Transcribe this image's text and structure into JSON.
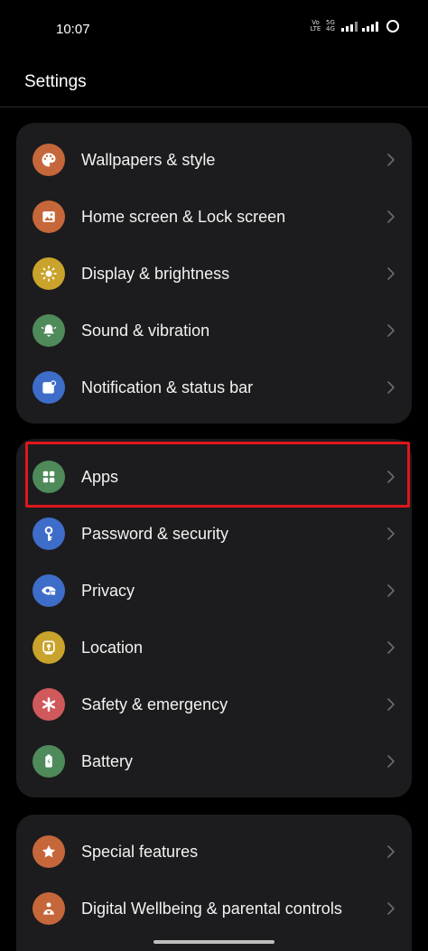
{
  "status_bar": {
    "time": "10:07",
    "volte_label": "Vo\nLTE",
    "network_label": "5G\n4G"
  },
  "header": {
    "title": "Settings"
  },
  "groups": [
    {
      "items": [
        {
          "label": "Wallpapers & style",
          "icon": "palette-icon",
          "color": "#c5673a"
        },
        {
          "label": "Home screen & Lock screen",
          "icon": "image-icon",
          "color": "#c5673a"
        },
        {
          "label": "Display & brightness",
          "icon": "sun-icon",
          "color": "#c9a32b"
        },
        {
          "label": "Sound & vibration",
          "icon": "bell-icon",
          "color": "#4f8a5a"
        },
        {
          "label": "Notification & status bar",
          "icon": "notification-icon",
          "color": "#3d6dc8"
        }
      ]
    },
    {
      "items": [
        {
          "label": "Apps",
          "icon": "apps-grid-icon",
          "color": "#4f8a5a"
        },
        {
          "label": "Password & security",
          "icon": "key-icon",
          "color": "#3d6dc8"
        },
        {
          "label": "Privacy",
          "icon": "eye-lock-icon",
          "color": "#3d6dc8"
        },
        {
          "label": "Location",
          "icon": "location-pin-icon",
          "color": "#c9a32b"
        },
        {
          "label": "Safety & emergency",
          "icon": "asterisk-icon",
          "color": "#d0595b"
        },
        {
          "label": "Battery",
          "icon": "battery-icon",
          "color": "#4f8a5a"
        }
      ]
    },
    {
      "items": [
        {
          "label": "Special features",
          "icon": "star-icon",
          "color": "#c5673a"
        },
        {
          "label": "Digital Wellbeing & parental controls",
          "icon": "wellbeing-icon",
          "color": "#c5673a"
        }
      ]
    }
  ],
  "colors": {
    "background": "#000000",
    "card": "#1c1c1e",
    "highlight_border": "#e0161c"
  }
}
